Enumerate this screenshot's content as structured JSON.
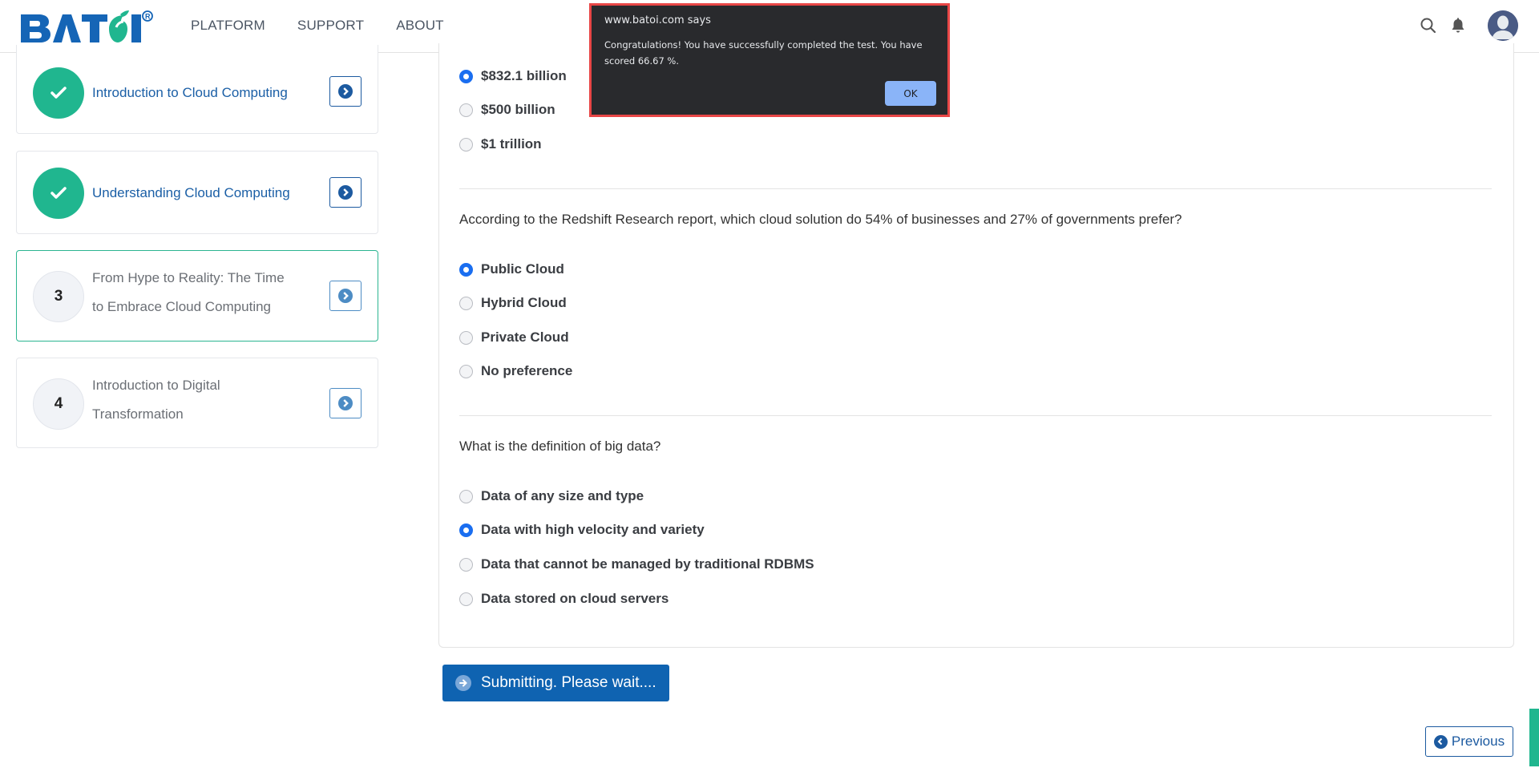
{
  "header": {
    "logo_text": "BATOI",
    "logo_mark": "®",
    "nav": [
      {
        "label": "PLATFORM"
      },
      {
        "label": "SUPPORT"
      },
      {
        "label": "ABOUT"
      }
    ],
    "icons": [
      "search-icon",
      "bell-icon",
      "user-avatar"
    ]
  },
  "colors": {
    "brand_blue": "#1565b6",
    "brand_green": "#20b68f",
    "radio_selected": "#1a6ef0",
    "dialog_bg": "#292a2d",
    "dialog_border": "#e84646",
    "ok_button": "#8ab4f8"
  },
  "sidebar": {
    "lessons": [
      {
        "status": "completed",
        "badge": "check-icon",
        "title": "Introduction to Cloud Computing"
      },
      {
        "status": "completed",
        "badge": "check-icon",
        "title": "Understanding Cloud Computing"
      },
      {
        "status": "active",
        "number": "3",
        "title_line1": "From Hype to Reality: The Time",
        "title_line2": "to Embrace Cloud Computing"
      },
      {
        "status": "pending",
        "number": "4",
        "title_line1": "Introduction to Digital",
        "title_line2": "Transformation"
      }
    ]
  },
  "quiz": {
    "questions": [
      {
        "text": "",
        "options": [
          {
            "label": "$832.1 billion",
            "selected": true
          },
          {
            "label": "$500 billion",
            "selected": false
          },
          {
            "label": "$1 trillion",
            "selected": false
          }
        ]
      },
      {
        "text": "According to the Redshift Research report, which cloud solution do 54% of businesses and 27% of governments prefer?",
        "options": [
          {
            "label": "Public Cloud",
            "selected": true
          },
          {
            "label": "Hybrid Cloud",
            "selected": false
          },
          {
            "label": "Private Cloud",
            "selected": false
          },
          {
            "label": "No preference",
            "selected": false
          }
        ]
      },
      {
        "text": "What is the definition of big data?",
        "options": [
          {
            "label": "Data of any size and type",
            "selected": false
          },
          {
            "label": "Data with high velocity and variety",
            "selected": true
          },
          {
            "label": "Data that cannot be managed by traditional RDBMS",
            "selected": false
          },
          {
            "label": "Data stored on cloud servers",
            "selected": false
          }
        ]
      }
    ],
    "submit_label": "Submitting. Please wait....",
    "previous_label": "Previous"
  },
  "dialog": {
    "title": "www.batoi.com says",
    "message": "Congratulations! You have successfully completed the test. You have scored 66.67 %.",
    "ok_label": "OK"
  }
}
